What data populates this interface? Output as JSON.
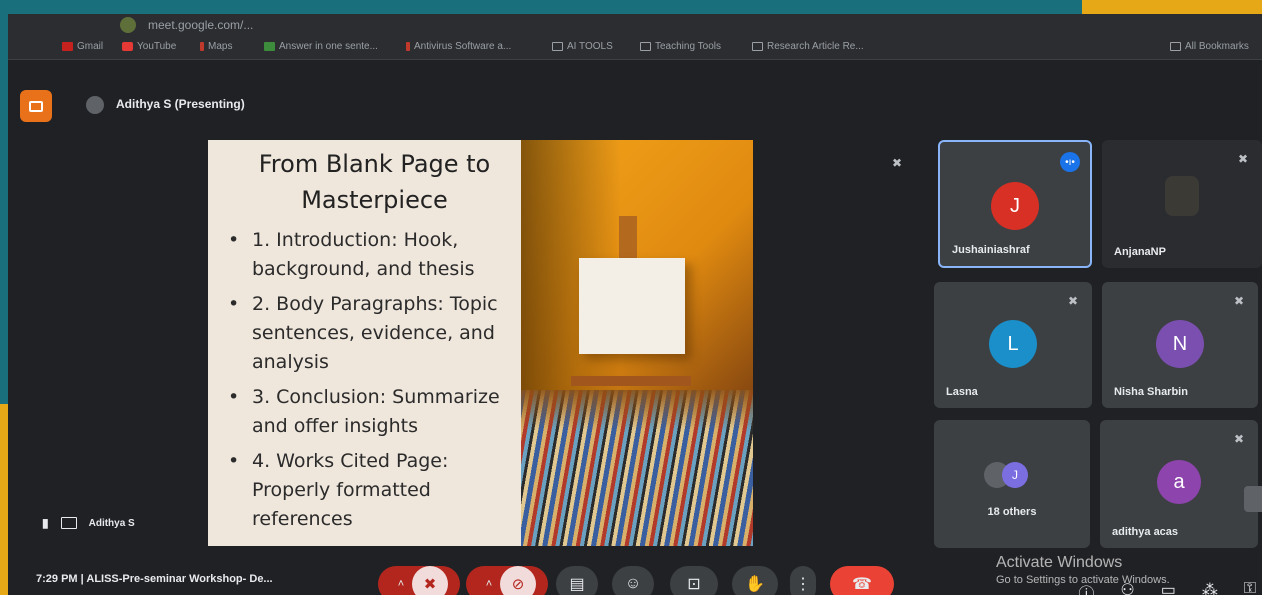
{
  "browser": {
    "url": "meet.google.com/...",
    "bookmarks": [
      {
        "label": "Gmail",
        "icon": "gmail-icon"
      },
      {
        "label": "YouTube",
        "icon": "youtube-icon"
      },
      {
        "label": "Maps",
        "icon": "maps-icon"
      },
      {
        "label": "Answer in one sente...",
        "icon": "app-icon"
      },
      {
        "label": "Antivirus Software a...",
        "icon": "antivirus-icon"
      },
      {
        "label": "AI TOOLS",
        "icon": "folder-icon"
      },
      {
        "label": "Teaching Tools",
        "icon": "folder-icon"
      },
      {
        "label": "Research Article Re...",
        "icon": "folder-icon"
      },
      {
        "label": "All Bookmarks",
        "icon": "folder-icon"
      }
    ]
  },
  "presenter": {
    "banner": "Adithya S (Presenting)",
    "tile_label": "Adithya S"
  },
  "slide": {
    "title": "From Blank Page to Masterpiece",
    "bullets": [
      "1. Introduction: Hook, background, and thesis",
      "2. Body Paragraphs: Topic sentences, evidence, and analysis",
      "3. Conclusion: Summarize and offer insights",
      "4. Works Cited Page: Properly formatted references"
    ]
  },
  "participants": [
    {
      "name": "Jushainiashraf",
      "initial": "J",
      "color": "#d93025",
      "speaking": true
    },
    {
      "name": "AnjanaNP",
      "initial": "",
      "color": "#3c4043",
      "speaking": false
    },
    {
      "name": "Lasna",
      "initial": "L",
      "color": "#1a8fc9",
      "speaking": false
    },
    {
      "name": "Nisha Sharbin",
      "initial": "N",
      "color": "#7b4fb0",
      "speaking": false
    },
    {
      "name": "18 others",
      "initial": "J",
      "color": "#7b6ee0",
      "speaking": false
    },
    {
      "name": "adithya acas",
      "initial": "a",
      "color": "#8e44ad",
      "speaking": false
    }
  ],
  "bottom_bar": {
    "time": "7:29 PM",
    "separator": "|",
    "meeting_name": "ALISS-Pre-seminar Workshop- De..."
  },
  "watermark": {
    "line1": "Activate Windows",
    "line2": "Go to Settings to activate Windows."
  }
}
